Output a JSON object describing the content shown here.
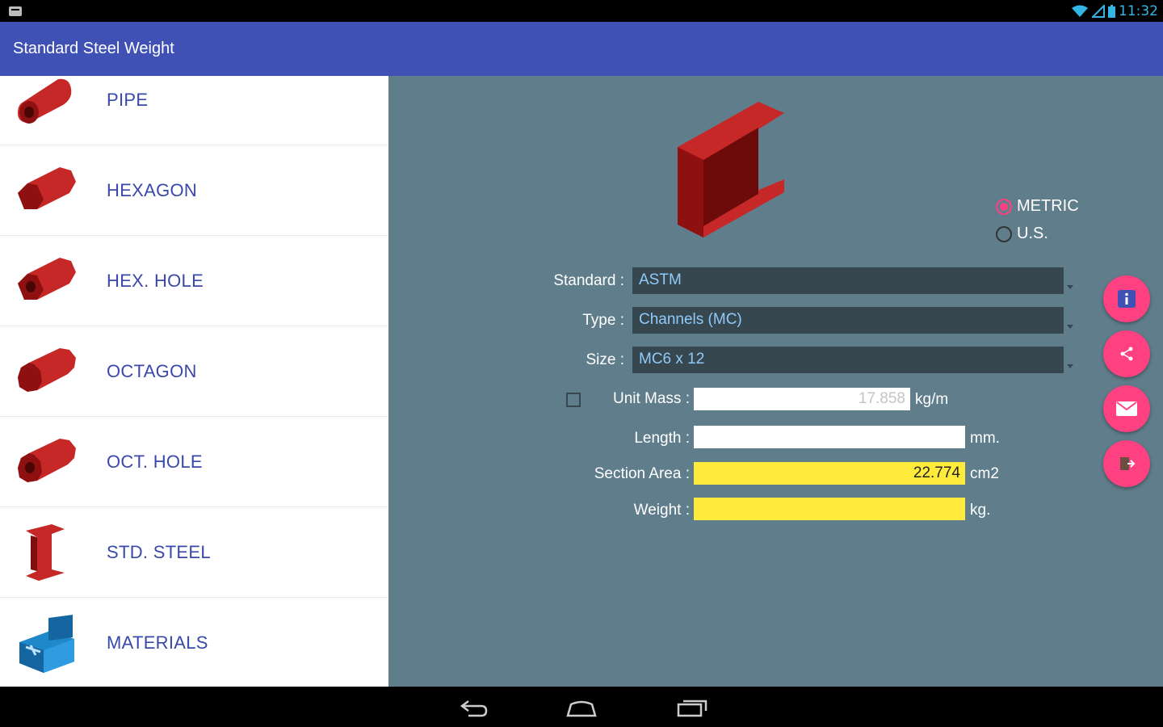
{
  "status_bar": {
    "time": "11:32"
  },
  "app_bar": {
    "title": "Standard Steel Weight"
  },
  "side_list": {
    "items": [
      {
        "label": "PIPE",
        "icon": "pipe-icon"
      },
      {
        "label": "HEXAGON",
        "icon": "hexagon-bar-icon"
      },
      {
        "label": "HEX. HOLE",
        "icon": "hex-hole-icon"
      },
      {
        "label": "OCTAGON",
        "icon": "octagon-bar-icon"
      },
      {
        "label": "OCT. HOLE",
        "icon": "oct-hole-icon"
      },
      {
        "label": "STD. STEEL",
        "icon": "i-beam-icon"
      },
      {
        "label": "MATERIALS",
        "icon": "toolbox-icon"
      }
    ]
  },
  "units": {
    "metric_label": "METRIC",
    "us_label": "U.S.",
    "selected": "METRIC"
  },
  "form": {
    "standard_label": "Standard :",
    "standard_value": "ASTM",
    "type_label": "Type :",
    "type_value": "Channels (MC)",
    "size_label": "Size :",
    "size_value": "MC6 x 12",
    "unit_mass_label": "Unit Mass :",
    "unit_mass_value": "17.858",
    "unit_mass_unit": "kg/m",
    "length_label": "Length :",
    "length_value": "",
    "length_unit": "mm.",
    "section_area_label": "Section Area :",
    "section_area_value": "22.774",
    "section_area_unit": "cm2",
    "weight_label": "Weight :",
    "weight_value": "",
    "weight_unit": "kg."
  },
  "colors": {
    "app_bar": "#3f51b5",
    "main_panel": "#607d8b",
    "accent": "#ff4081",
    "result_field": "#ffeb3b",
    "list_text": "#3949ab"
  },
  "actions": [
    "info-icon",
    "share-icon",
    "email-icon",
    "exit-icon"
  ]
}
